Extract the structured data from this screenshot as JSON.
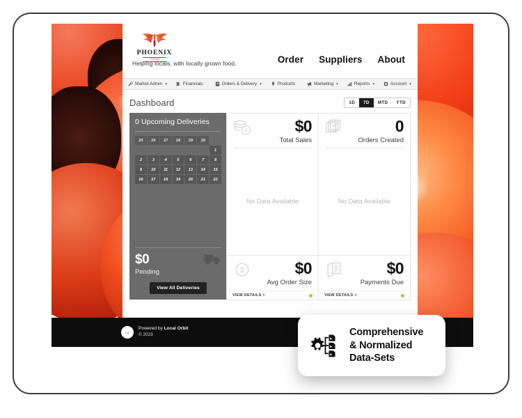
{
  "site": {
    "brand_name": "PHOENIX",
    "brand_sub": "FOODS",
    "tagline": "Helping locals, with locally grown food.",
    "nav": [
      {
        "label": "Order"
      },
      {
        "label": "Suppliers"
      },
      {
        "label": "About"
      }
    ]
  },
  "admin_bar": [
    {
      "label": "Market Admin",
      "icon": "wrench-icon",
      "caret": "▾"
    },
    {
      "label": "Financials",
      "icon": "money-icon",
      "caret": ""
    },
    {
      "label": "Orders & Delivery",
      "icon": "clipboard-icon",
      "caret": "▾"
    },
    {
      "label": "Products",
      "icon": "carrot-icon",
      "caret": ""
    },
    {
      "label": "Marketing",
      "icon": "megaphone-icon",
      "caret": "▾"
    },
    {
      "label": "Reports",
      "icon": "bar-chart-icon",
      "caret": "▾"
    },
    {
      "label": "Account",
      "icon": "card-icon",
      "caret": "▾"
    }
  ],
  "dashboard": {
    "title": "Dashboard",
    "range_options": [
      {
        "label": "1D",
        "active": false
      },
      {
        "label": "7D",
        "active": true
      },
      {
        "label": "MTD",
        "active": false
      },
      {
        "label": "YTD",
        "active": false
      }
    ],
    "deliveries": {
      "title": "0 Upcoming Deliveries",
      "calendar_rows": [
        [
          "25",
          "26",
          "27",
          "28",
          "29",
          "30",
          ""
        ],
        [
          "",
          "",
          "",
          "",
          "",
          "",
          "1"
        ],
        [
          "2",
          "3",
          "4",
          "5",
          "6",
          "7",
          "8"
        ],
        [
          "9",
          "10",
          "11",
          "12",
          "13",
          "14",
          "15"
        ],
        [
          "16",
          "17",
          "18",
          "19",
          "20",
          "21",
          "22"
        ]
      ],
      "pending_amount": "$0",
      "pending_label": "Pending",
      "truck_icon": "truck-icon",
      "button_label": "View All Deliveries"
    },
    "cards": [
      {
        "value": "$0",
        "label": "Total Sales",
        "icon": "coins-icon",
        "empty_text": "No Data Available",
        "footer": null
      },
      {
        "value": "0",
        "label": "Orders Created",
        "icon": "orders-check-icon",
        "empty_text": "No Data Available",
        "footer": null
      },
      {
        "value": "$0",
        "label": "Avg Order Size",
        "icon": "dollar-circle-icon",
        "empty_text": "",
        "footer": {
          "link": "VIEW DETAILS >",
          "dot_color": "#e8a33d"
        }
      },
      {
        "value": "$0",
        "label": "Payments Due",
        "icon": "invoice-icon",
        "empty_text": "",
        "footer": {
          "link": "VIEW DETAILS >",
          "dot_color": "#e8a33d"
        }
      }
    ]
  },
  "footer": {
    "logo_text": "LO",
    "powered_prefix": "Powered by ",
    "powered_brand": "Local Orbit",
    "copyright": "© 2023"
  },
  "callout": {
    "icon": "gear-data-sets-icon",
    "line1": "Comprehensive",
    "line2": "& Normalized",
    "line3": "Data-Sets"
  },
  "colors": {
    "accent_amber": "#e8a33d",
    "panel_gray": "#6b6b6b",
    "active_dark": "#1c1c1c",
    "tomato_red": "#e8431f"
  }
}
